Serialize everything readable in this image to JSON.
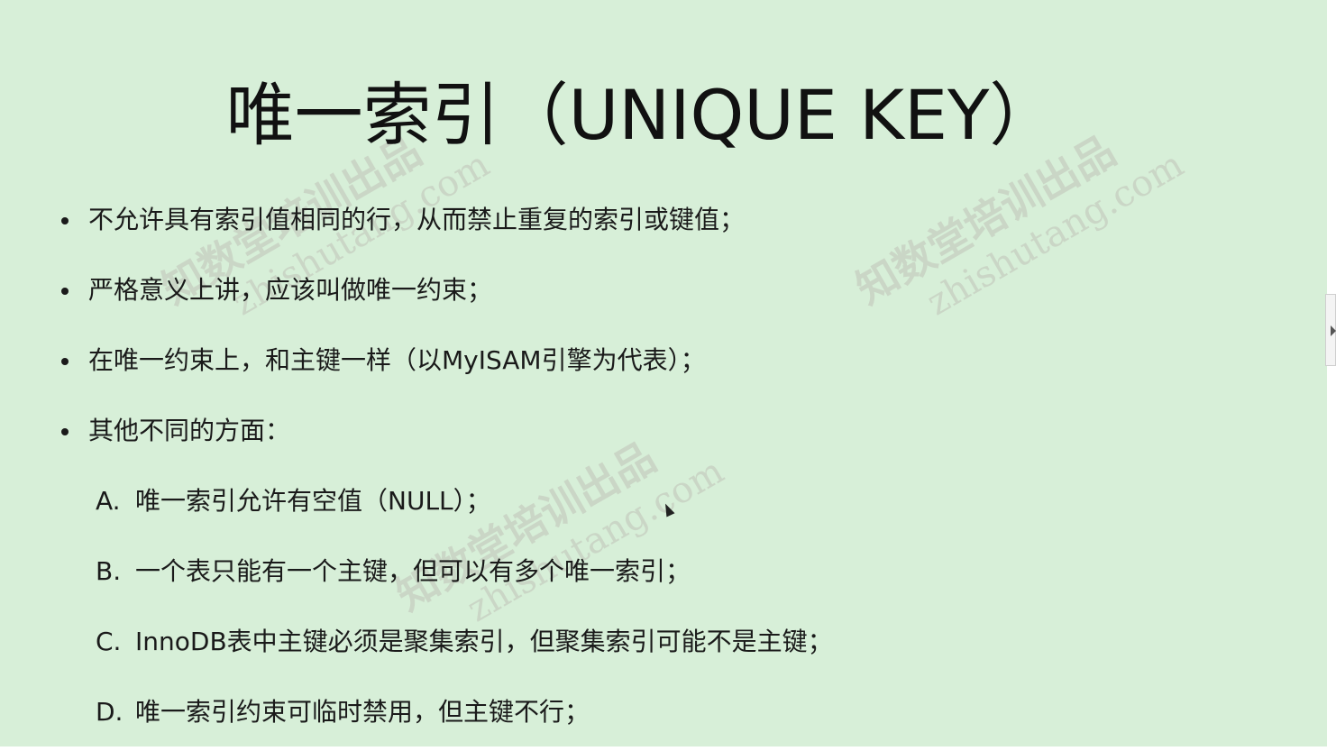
{
  "slide": {
    "title": "唯一索引（UNIQUE KEY）",
    "bullets": [
      "不允许具有索引值相同的行，从而禁止重复的索引或键值；",
      "严格意义上讲，应该叫做唯一约束；",
      "在唯一约束上，和主键一样（以MyISAM引擎为代表）；",
      "其他不同的方面："
    ],
    "sub_items": [
      {
        "letter": "A.",
        "text": "唯一索引允许有空值（NULL）；"
      },
      {
        "letter": "B.",
        "text": "一个表只能有一个主键，但可以有多个唯一索引；"
      },
      {
        "letter": "C.",
        "text": "InnoDB表中主键必须是聚集索引，但聚集索引可能不是主键；"
      },
      {
        "letter": "D.",
        "text": "唯一索引约束可临时禁用，但主键不行；"
      }
    ]
  },
  "watermark": {
    "cn": "知数堂培训出品",
    "en": "zhishutang.com"
  },
  "colors": {
    "background": "#d7efd8",
    "text": "#1a1a1a"
  }
}
